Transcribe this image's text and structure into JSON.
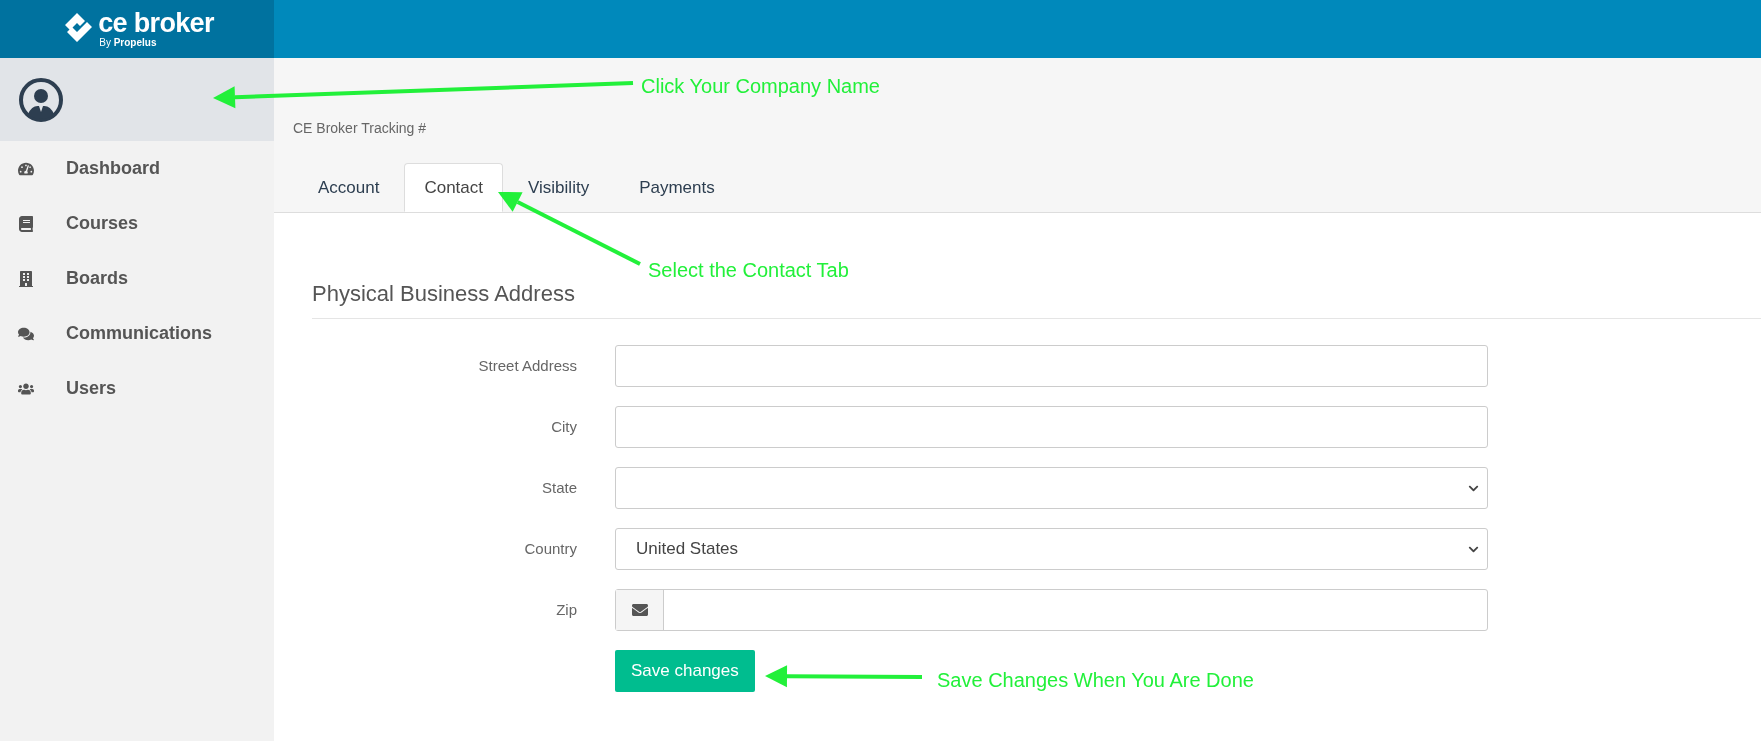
{
  "header": {
    "logo_text": "ce broker",
    "logo_subtext": "By **Propelus**"
  },
  "sidebar": {
    "items": [
      {
        "label": "Dashboard"
      },
      {
        "label": "Courses"
      },
      {
        "label": "Boards"
      },
      {
        "label": "Communications"
      },
      {
        "label": "Users"
      }
    ]
  },
  "tracking": "CE Broker Tracking #",
  "tabs": [
    {
      "label": "Account",
      "selected": false
    },
    {
      "label": "Contact",
      "selected": true
    },
    {
      "label": "Visibility",
      "selected": false
    },
    {
      "label": "Payments",
      "selected": false
    }
  ],
  "section_title": "Physical Business Address",
  "fields": [
    {
      "label": "Street Address",
      "kind": "text"
    },
    {
      "label": "City",
      "kind": "text"
    },
    {
      "label": "State",
      "kind": "select"
    },
    {
      "label": "Country",
      "kind": "select",
      "value": "United States"
    },
    {
      "label": "Zip",
      "kind": "addon"
    }
  ],
  "save_button": "Save changes",
  "annotations": [
    {
      "text": "Click Your Company Name"
    },
    {
      "text": "Select the Contact Tab"
    },
    {
      "text": "Save Changes When You Are Done"
    }
  ]
}
